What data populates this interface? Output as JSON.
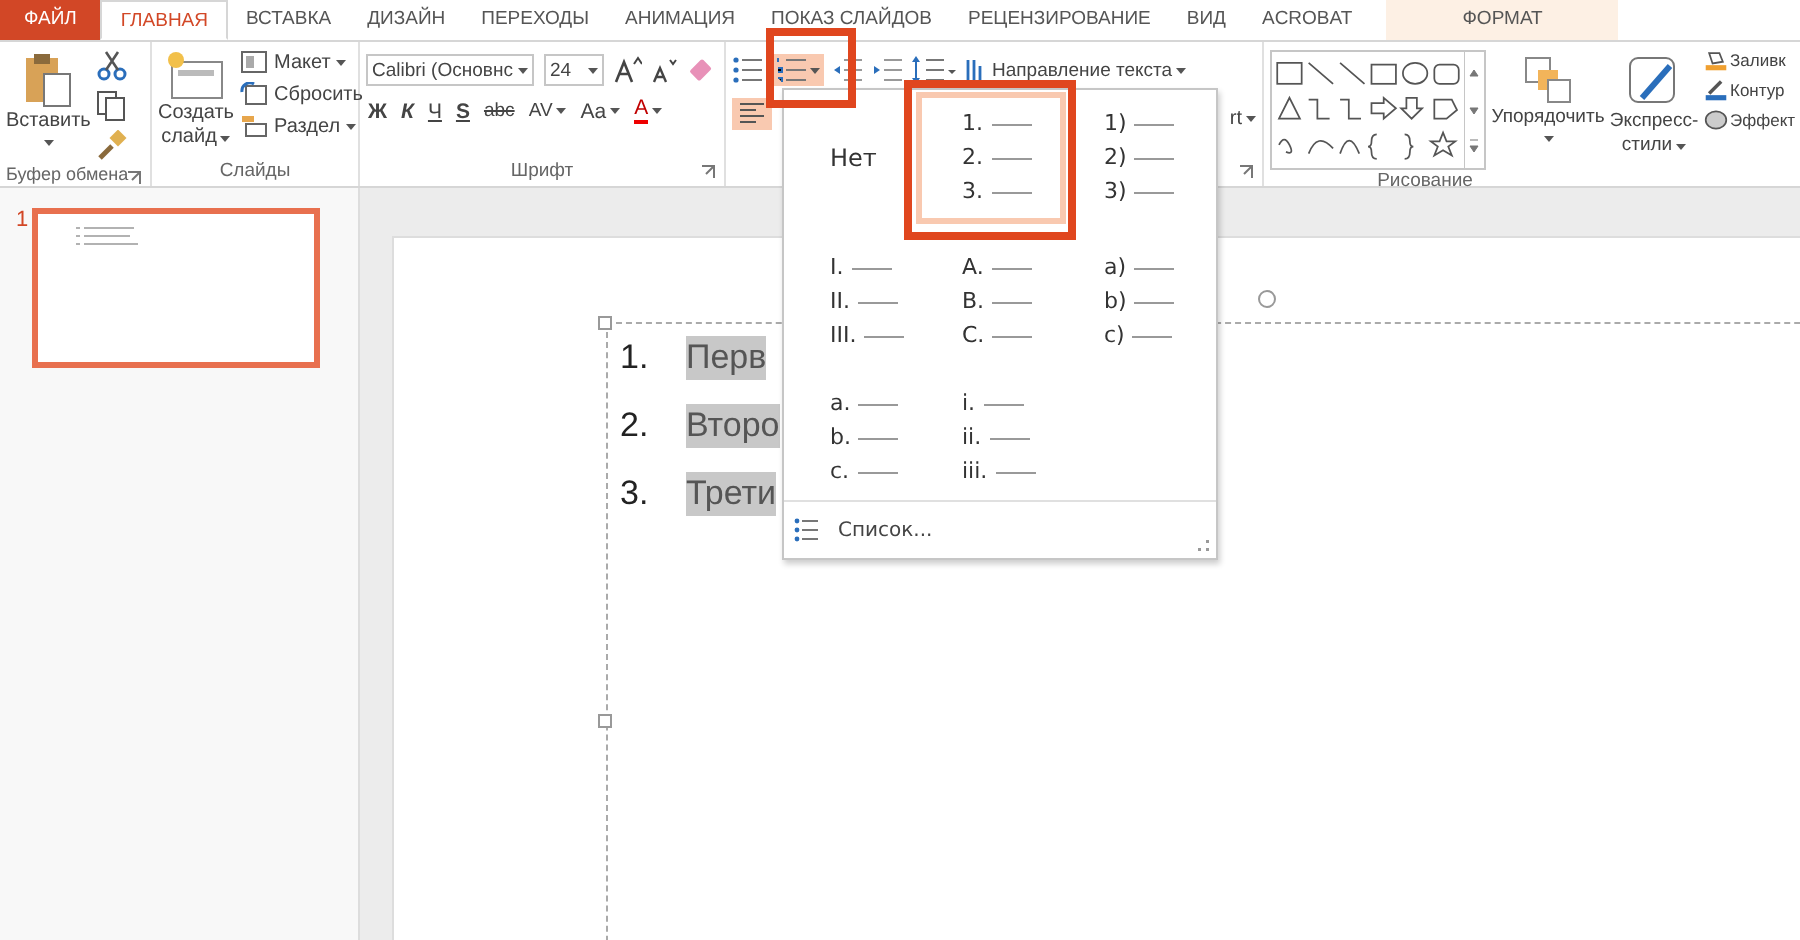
{
  "tabs": [
    {
      "label": "ФАЙЛ",
      "kind": "file",
      "selected": false
    },
    {
      "label": "ГЛАВНАЯ",
      "kind": "normal",
      "selected": true
    },
    {
      "label": "ВСТАВКА",
      "kind": "normal",
      "selected": false
    },
    {
      "label": "ДИЗАЙН",
      "kind": "normal",
      "selected": false
    },
    {
      "label": "ПЕРЕХОДЫ",
      "kind": "normal",
      "selected": false
    },
    {
      "label": "АНИМАЦИЯ",
      "kind": "normal",
      "selected": false
    },
    {
      "label": "ПОКАЗ СЛАЙДОВ",
      "kind": "normal",
      "selected": false
    },
    {
      "label": "РЕЦЕНЗИРОВАНИЕ",
      "kind": "normal",
      "selected": false
    },
    {
      "label": "ВИД",
      "kind": "normal",
      "selected": false
    },
    {
      "label": "ACROBAT",
      "kind": "normal",
      "selected": false
    },
    {
      "label": "ФОРМАТ",
      "kind": "contextual",
      "selected": false
    }
  ],
  "clipboard": {
    "paste": "Вставить",
    "label": "Буфер обмена"
  },
  "slides": {
    "new_slide": [
      "Создать",
      "слайд"
    ],
    "layout": "Макет",
    "reset": "Сбросить",
    "section": "Раздел",
    "label": "Слайды"
  },
  "font": {
    "family": "Calibri (Основнс",
    "size": "24",
    "bold": "Ж",
    "italic": "К",
    "underline": "Ч",
    "shadow": "S",
    "strike": "abc",
    "spacing": "AV",
    "case": "Aa",
    "color_button": "A",
    "label": "Шрифт"
  },
  "paragraph": {
    "numbering_selected": true,
    "align_left_selected": true,
    "text_direction": "Направление текста",
    "smartart": "rt"
  },
  "drawing": {
    "arrange": "Упорядочить",
    "styles": [
      "Экспресс-",
      "стили"
    ],
    "fill": "Заливк",
    "outline": "Контур",
    "effects": "Эффект",
    "label": "Рисование"
  },
  "thumbnail": {
    "number": "1",
    "selected": true
  },
  "slide_lines": [
    {
      "number": "1.",
      "text": "Перв",
      "highlighted": true
    },
    {
      "number": "2.",
      "text": "Второ",
      "highlighted": true
    },
    {
      "number": "3.",
      "text": "Трети",
      "highlighted": true
    }
  ],
  "numbering_menu": {
    "rows": [
      [
        {
          "kind": "none",
          "text": "Нет",
          "selected": false
        },
        {
          "kind": "list",
          "markers": [
            "1.",
            "2.",
            "3."
          ],
          "selected": true
        },
        {
          "kind": "list",
          "markers": [
            "1)",
            "2)",
            "3)"
          ],
          "selected": false
        }
      ],
      [
        {
          "kind": "list",
          "markers": [
            "I.",
            "II.",
            "III."
          ],
          "selected": false
        },
        {
          "kind": "list",
          "markers": [
            "A.",
            "B.",
            "C."
          ],
          "selected": false
        },
        {
          "kind": "list",
          "markers": [
            "a)",
            "b)",
            "c)"
          ],
          "selected": false
        }
      ],
      [
        {
          "kind": "list",
          "markers": [
            "a.",
            "b.",
            "c."
          ],
          "selected": false
        },
        {
          "kind": "list",
          "markers": [
            "i.",
            "ii.",
            "iii."
          ],
          "selected": false
        }
      ]
    ],
    "footer": "Список..."
  }
}
